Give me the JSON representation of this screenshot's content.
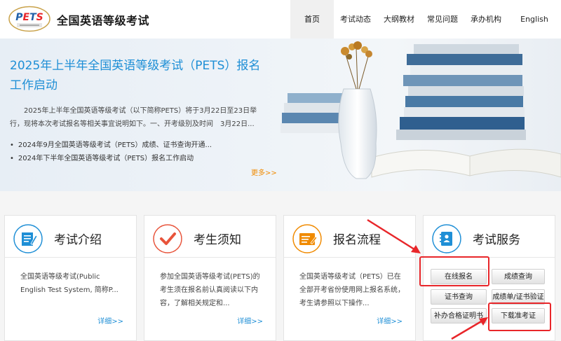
{
  "header": {
    "logo_text": "PETS",
    "logo_subtext": "全国英语等级考试",
    "site_title": "全国英语等级考试",
    "nav": [
      "首页",
      "考试动态",
      "大纲教材",
      "常见问题",
      "承办机构",
      "English"
    ],
    "active_nav": "首页"
  },
  "banner": {
    "title": "2025年上半年全国英语等级考试（PETS）报名工作启动",
    "summary": "2025年上半年全国英语等级考试（以下简称PETS）将于3月22日至23日举行，现将本次考试报名等相关事宜说明如下。一、开考级别及时间　3月22日...",
    "list": [
      "2024年9月全国英语等级考试（PETS）成绩、证书查询开通...",
      "2024年下半年全国英语等级考试（PETS）报名工作启动"
    ],
    "more": "更多>>"
  },
  "cards": [
    {
      "title": "考试介绍",
      "desc": "全国英语等级考试(Public English Test System, 简称P...",
      "more": "详细>>",
      "icon": "document-edit-icon"
    },
    {
      "title": "考生须知",
      "desc": "参加全国英语等级考试(PETS)的考生须在报名前认真阅读以下内容，了解相关规定和...",
      "more": "详细>>",
      "icon": "checkmark-icon"
    },
    {
      "title": "报名流程",
      "desc": "全国英语等级考试（PETS）已在全部开考省份使用网上报名系统，考生请参照以下操作...",
      "more": "详细>>",
      "icon": "register-form-icon"
    },
    {
      "title": "考试服务",
      "icon": "address-book-icon"
    }
  ],
  "services": {
    "online_register": "在线报名",
    "score_query": "成绩查询",
    "cert_query": "证书查询",
    "score_cert_verify": "成绩单/证书验证",
    "reissue_cert": "补办合格证明书",
    "download_ticket": "下载准考证"
  },
  "colors": {
    "accent_blue": "#1f8fd6",
    "icon_orange": "#f08a00",
    "icon_red": "#e8543b",
    "highlight_red": "#e8262a"
  }
}
